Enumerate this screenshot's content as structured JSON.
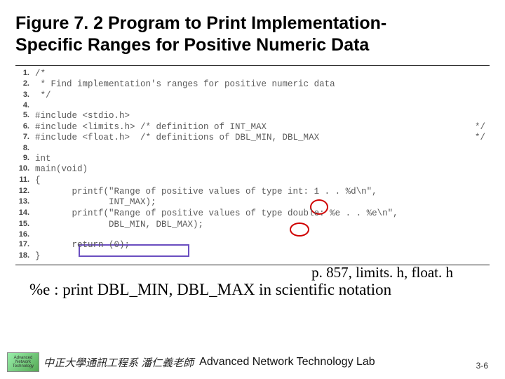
{
  "title_line1": "Figure 7. 2  Program to Print Implementation-",
  "title_line2": "Specific Ranges for Positive Numeric Data",
  "code": {
    "lines": [
      {
        "n": "1.",
        "t": "/*"
      },
      {
        "n": "2.",
        "t": " * Find implementation's ranges for positive numeric data"
      },
      {
        "n": "3.",
        "t": " */"
      },
      {
        "n": "4.",
        "t": ""
      },
      {
        "n": "5.",
        "t": "#include <stdio.h>"
      },
      {
        "n": "6.",
        "t": "#include <limits.h> /* definition of INT_MAX",
        "r": "*/"
      },
      {
        "n": "7.",
        "t": "#include <float.h>  /* definitions of DBL_MIN, DBL_MAX",
        "r": "*/"
      },
      {
        "n": "8.",
        "t": ""
      },
      {
        "n": "9.",
        "t": "int"
      },
      {
        "n": "10.",
        "t": "main(void)"
      },
      {
        "n": "11.",
        "t": "{"
      },
      {
        "n": "12.",
        "t": "       printf(\"Range of positive values of type int: 1 . . %d\\n\","
      },
      {
        "n": "13.",
        "t": "              INT_MAX);"
      },
      {
        "n": "14.",
        "t": "       printf(\"Range of positive values of type double: %e . . %e\\n\","
      },
      {
        "n": "15.",
        "t": "              DBL_MIN, DBL_MAX);"
      },
      {
        "n": "16.",
        "t": ""
      },
      {
        "n": "17.",
        "t": "       return (0);"
      },
      {
        "n": "18.",
        "t": "}"
      }
    ]
  },
  "annotation_right": "p. 857, limits. h, float. h",
  "note": "%e : print DBL_MIN, DBL_MAX in scientific notation",
  "footer": {
    "logo_text": "Advanced Network Technology",
    "cn": "中正大學通訊工程系 潘仁義老師",
    "en": "Advanced Network Technology Lab"
  },
  "slide_number": "3-6"
}
